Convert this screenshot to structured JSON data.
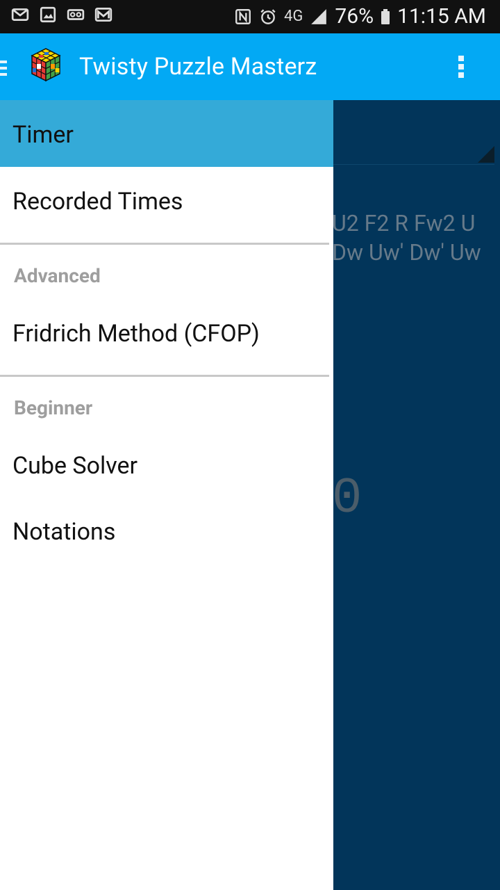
{
  "status_bar": {
    "left_icons": [
      "mail-icon",
      "image-icon",
      "voicemail-icon",
      "gmail-icon"
    ],
    "right_icons": [
      "nfc-icon",
      "alarm-icon",
      "network-4g-icon",
      "signal-icon",
      "battery-icon"
    ],
    "network_label": "4G",
    "battery": "76%",
    "time": "11:15 AM"
  },
  "app_bar": {
    "title": "Twisty Puzzle Masterz",
    "menu_icon": "hamburger-icon",
    "overflow_icon": "overflow-menu-icon"
  },
  "background": {
    "scramble_line1": "U2 F2 R Fw2 U",
    "scramble_line2": "Dw Uw' Dw' Uw",
    "timer_digits": "0"
  },
  "drawer": {
    "items": [
      {
        "label": "Timer",
        "active": true
      },
      {
        "label": "Recorded Times",
        "active": false
      }
    ],
    "advanced": {
      "title": "Advanced",
      "items": [
        {
          "label": "Fridrich Method (CFOP)"
        }
      ]
    },
    "beginner": {
      "title": "Beginner",
      "items": [
        {
          "label": "Cube Solver"
        },
        {
          "label": "Notations"
        }
      ]
    }
  },
  "colors": {
    "app_bar": "#03a9f4",
    "active_item": "#34aad8",
    "background": "#02355a"
  }
}
